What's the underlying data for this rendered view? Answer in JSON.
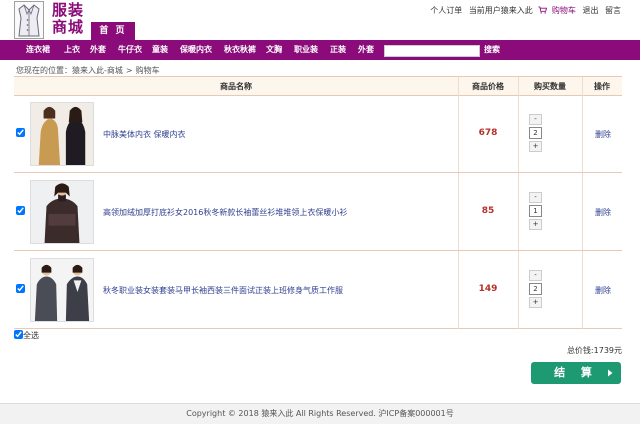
{
  "header": {
    "logo_text": "服装商城",
    "home_tab": "首 页",
    "links": {
      "orders": "个人订单",
      "current_user": "当前用户猿来入此",
      "cart": "购物车",
      "logout": "退出",
      "message": "留言"
    }
  },
  "nav": {
    "items": [
      "连衣裙",
      "上衣",
      "外套",
      "牛仔衣",
      "童装",
      "保暖内衣",
      "秋衣秋裤",
      "文胸",
      "职业装",
      "正装",
      "外套"
    ],
    "search_value": "",
    "search_button": "搜索"
  },
  "breadcrumb": {
    "prefix": "您现在的位置：",
    "site": "猿来入此-商城",
    "separator": ">",
    "current": "购物车"
  },
  "table": {
    "headers": {
      "name": "商品名称",
      "price": "商品价格",
      "qty": "购买数量",
      "action": "操作"
    },
    "rows": [
      {
        "checked": true,
        "image": "lingerie-product-photo",
        "name": "中脉美体内衣 保暖内衣",
        "price": "678",
        "minus": "-",
        "qty": "2",
        "plus": "+",
        "action": "删除"
      },
      {
        "checked": true,
        "image": "knit-top-product-photo",
        "name": "高领加绒加厚打底衫女2016秋冬新款长袖蕾丝衫堆堆领上衣保暖小衫",
        "price": "85",
        "minus": "-",
        "qty": "1",
        "plus": "+",
        "action": "删除"
      },
      {
        "checked": true,
        "image": "business-suit-product-photo",
        "name": "秋冬职业装女装套装马甲长袖西装三件面试正装上班修身气质工作服",
        "price": "149",
        "minus": "-",
        "qty": "2",
        "plus": "+",
        "action": "删除"
      }
    ]
  },
  "select_all": "全选",
  "total": {
    "label": "总价钱:",
    "value": "1739元"
  },
  "checkout_button": "结 算",
  "footer": "Copyright © 2018 猿来入此 All Rights Reserved. 沪ICP备案000001号",
  "colors": {
    "brand": "#8a0b79",
    "price": "#b5322b",
    "link": "#2f3f8f",
    "checkout": "#1e9a72"
  }
}
